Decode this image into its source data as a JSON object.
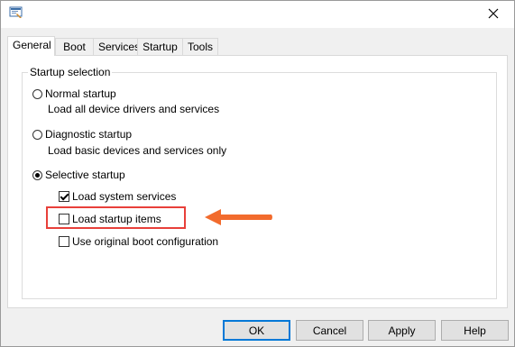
{
  "tabs": [
    "General",
    "Boot",
    "Services",
    "Startup",
    "Tools"
  ],
  "group": {
    "label": "Startup selection",
    "normal": {
      "label": "Normal startup",
      "desc": "Load all device drivers and services"
    },
    "diagnostic": {
      "label": "Diagnostic startup",
      "desc": "Load basic devices and services only"
    },
    "selective": {
      "label": "Selective startup"
    },
    "checkboxes": [
      {
        "label": "Load system services",
        "checked": true
      },
      {
        "label": "Load startup items",
        "checked": false
      },
      {
        "label": "Use original boot configuration",
        "checked": false
      }
    ]
  },
  "buttons": {
    "ok": "OK",
    "cancel": "Cancel",
    "apply": "Apply",
    "help": "Help"
  },
  "colors": {
    "highlight": "#e8403a",
    "arrow": "#f26b2d",
    "accent": "#0078d7"
  },
  "icons": {
    "app": "msconfig-icon",
    "close": "close-icon",
    "arrow": "arrow-left-icon"
  }
}
